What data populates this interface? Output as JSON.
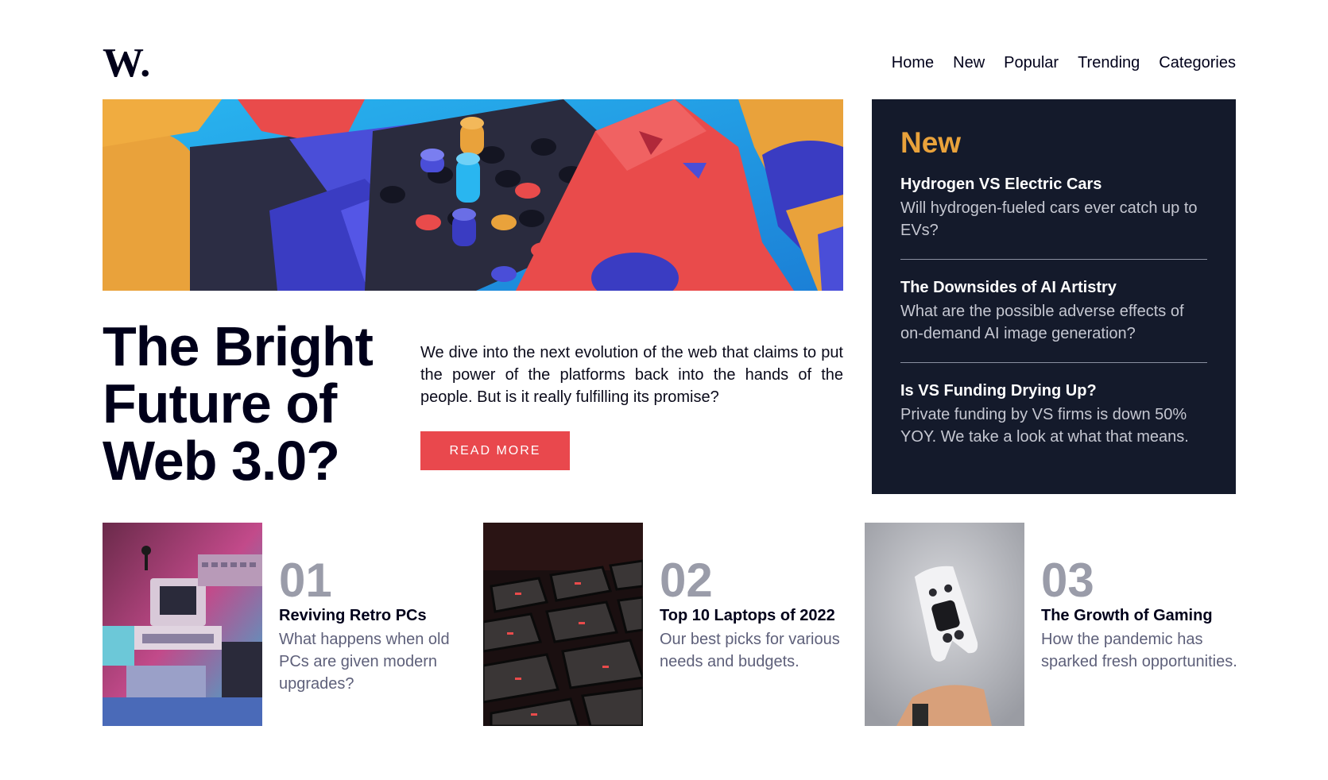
{
  "header": {
    "logo_text": "W.",
    "nav": [
      "Home",
      "New",
      "Popular",
      "Trending",
      "Categories"
    ]
  },
  "hero": {
    "title_lines": [
      "The Bright",
      "Future of",
      "Web 3.0?"
    ],
    "description": "We dive into the next evolution of the web that claims to put the power of the platforms back into the hands of the people. But is it really fulfilling its promise?",
    "button_label": "READ MORE"
  },
  "new_panel": {
    "title": "New",
    "items": [
      {
        "title": "Hydrogen VS Electric Cars",
        "desc": "Will hydrogen-fueled cars ever catch up to EVs?"
      },
      {
        "title": "The Downsides of AI Artistry",
        "desc": "What are the possible adverse effects of on-demand AI image generation?"
      },
      {
        "title": "Is VS Funding Drying Up?",
        "desc": "Private funding by VS firms is down 50% YOY. We take a look at what that means."
      }
    ]
  },
  "cards": [
    {
      "num": "01",
      "title": "Reviving Retro PCs",
      "desc": "What happens when old PCs are given modern upgrades?"
    },
    {
      "num": "02",
      "title": "Top 10 Laptops of 2022",
      "desc": "Our best picks for various needs and budgets."
    },
    {
      "num": "03",
      "title": "The Growth of Gaming",
      "desc": "How the pandemic has sparked fresh opportunities."
    }
  ],
  "colors": {
    "accent": "#e9484d",
    "panel_bg": "#141a2b",
    "panel_title": "#e9a23b",
    "number": "#9a9ca9"
  }
}
